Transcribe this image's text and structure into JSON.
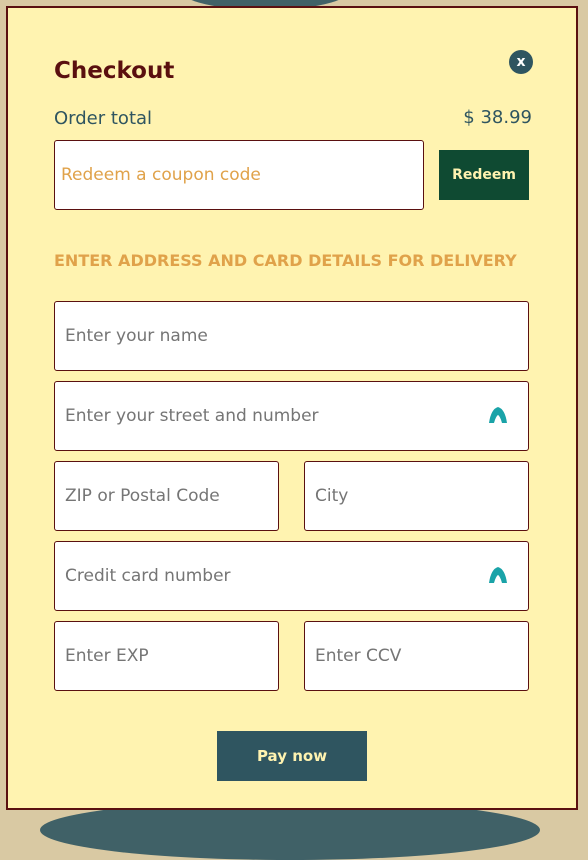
{
  "modal": {
    "title": "Checkout",
    "close_label": "x",
    "order_total_label": "Order total",
    "order_total_value": "$ 38.99"
  },
  "coupon": {
    "placeholder": "Redeem a coupon code",
    "redeem_label": "Redeem"
  },
  "section": {
    "heading": "ENTER ADDRESS AND CARD DETAILS FOR DELIVERY"
  },
  "fields": {
    "name": "Enter your name",
    "street": "Enter your street and number",
    "zip": "ZIP or Postal Code",
    "city": "City",
    "card": "Credit card number",
    "exp": "Enter EXP",
    "ccv": "Enter CCV"
  },
  "icons": {
    "autofill": "autofill-icon"
  },
  "actions": {
    "pay_label": "Pay now"
  },
  "colors": {
    "panel_bg": "#fff3b0",
    "title": "#5a0f0f",
    "accent_orange": "#e0a24a",
    "redeem_bg": "#0f4a32",
    "pay_bg": "#2f5560",
    "border": "#5a1010",
    "autofill_icon": "#1aa3a8"
  }
}
